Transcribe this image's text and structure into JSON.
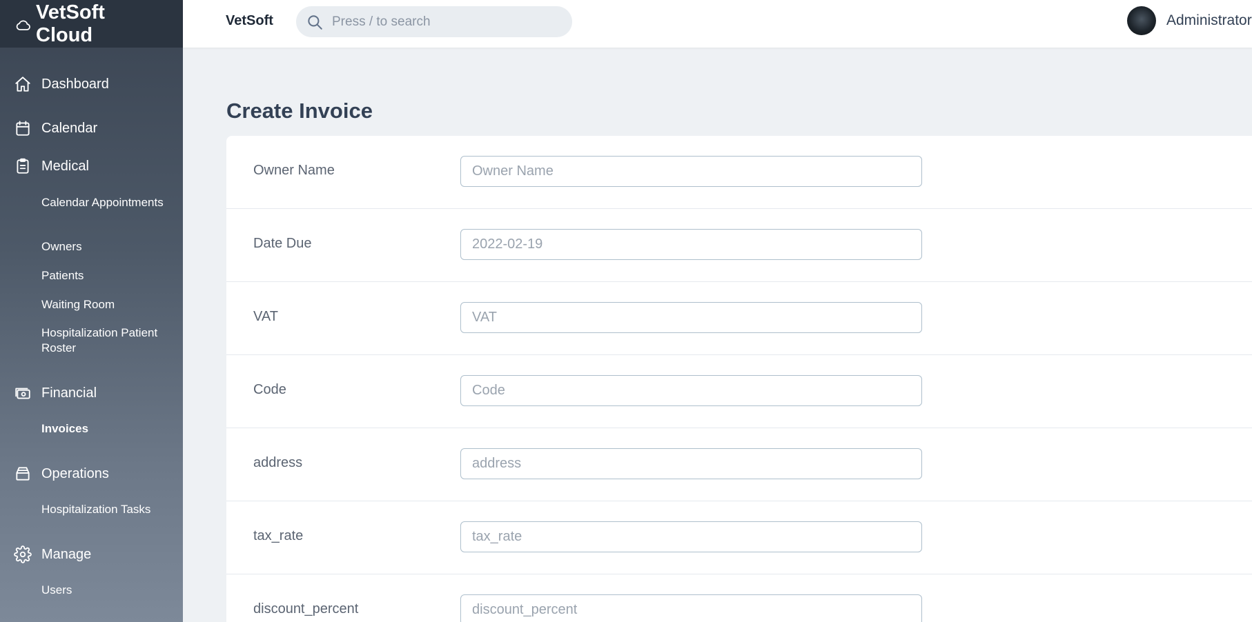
{
  "brand": {
    "name": "VetSoft Cloud",
    "icon": "cloud-icon"
  },
  "sidebar": {
    "sections": [
      {
        "label": "Dashboard",
        "icon": "home-icon"
      },
      {
        "label": "Calendar",
        "icon": "calendar-icon"
      },
      {
        "label": "Medical",
        "icon": "clipboard-icon",
        "items": [
          "Calendar Appointments",
          "Owners",
          "Patients",
          "Waiting Room",
          "Hospitalization Patient Roster"
        ]
      },
      {
        "label": "Financial",
        "icon": "cash-icon",
        "items": [
          "Invoices"
        ]
      },
      {
        "label": "Operations",
        "icon": "inbox-icon",
        "items": [
          "Hospitalization Tasks"
        ]
      },
      {
        "label": "Manage",
        "icon": "gear-icon",
        "items": [
          "Users"
        ]
      }
    ],
    "active_item": "Invoices"
  },
  "header": {
    "title": "VetSoft",
    "search": {
      "placeholder": "Press / to search",
      "value": ""
    },
    "user": {
      "name": "Administrator"
    }
  },
  "page": {
    "title": "Create Invoice",
    "fields": [
      {
        "label": "Owner Name",
        "placeholder": "Owner Name",
        "value": ""
      },
      {
        "label": "Date Due",
        "placeholder": "2022-02-19",
        "value": ""
      },
      {
        "label": "VAT",
        "placeholder": "VAT",
        "value": ""
      },
      {
        "label": "Code",
        "placeholder": "Code",
        "value": ""
      },
      {
        "label": "address",
        "placeholder": "address",
        "value": ""
      },
      {
        "label": "tax_rate",
        "placeholder": "tax_rate",
        "value": ""
      },
      {
        "label": "discount_percent",
        "placeholder": "discount_percent",
        "value": ""
      }
    ]
  },
  "colors": {
    "sidebar_top": "#3a4452",
    "sidebar_bottom": "#7d8999",
    "brand_bg": "#2b3440",
    "page_bg": "#eef1f4",
    "input_border": "#aebfcc"
  }
}
